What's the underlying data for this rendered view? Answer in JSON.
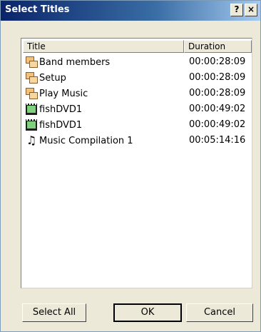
{
  "window": {
    "title": "Select Titles",
    "help_label": "?",
    "close_label": "×"
  },
  "list": {
    "columns": {
      "title": "Title",
      "duration": "Duration"
    },
    "rows": [
      {
        "icon": "chapter-icon",
        "title": "Band members",
        "duration": "00:00:28:09"
      },
      {
        "icon": "chapter-icon",
        "title": "Setup",
        "duration": "00:00:28:09"
      },
      {
        "icon": "chapter-icon",
        "title": "Play Music",
        "duration": "00:00:28:09"
      },
      {
        "icon": "film-icon",
        "title": "fishDVD1",
        "duration": "00:00:49:02"
      },
      {
        "icon": "film-icon",
        "title": "fishDVD1",
        "duration": "00:00:49:02"
      },
      {
        "icon": "music-note-icon",
        "title": "Music Compilation 1",
        "duration": "00:05:14:16"
      }
    ]
  },
  "buttons": {
    "select_all": "Select All",
    "ok": "OK",
    "cancel": "Cancel"
  }
}
